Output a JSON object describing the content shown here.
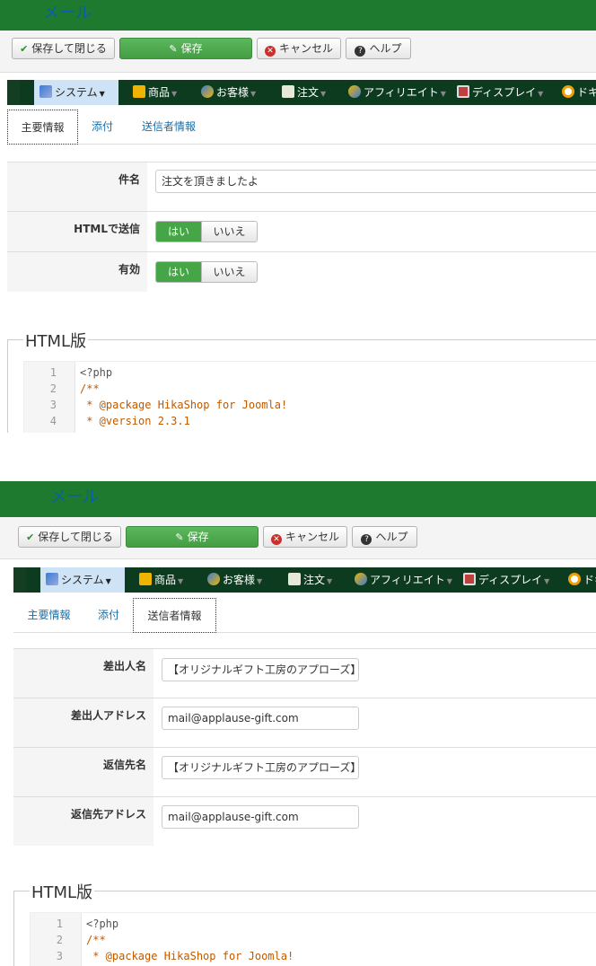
{
  "panel1": {
    "title": "メール",
    "toolbar": {
      "save_close": "保存して閉じる",
      "save": "保存",
      "cancel": "キャンセル",
      "help": "ヘルプ"
    },
    "menu": [
      "システム",
      "商品",
      "お客様",
      "注文",
      "アフィリエイト",
      "ディスプレイ",
      "ドキュ"
    ],
    "tabs": [
      "主要情報",
      "添付",
      "送信者情報"
    ],
    "active_tab": "主要情報",
    "fields": {
      "subject_label": "件名",
      "subject_value": "注文を頂きましたよ",
      "html_label": "HTMLで送信",
      "enabled_label": "有効",
      "yes": "はい",
      "no": "いいえ"
    },
    "html_version_legend": "HTML版",
    "code": [
      {
        "n": "1",
        "t": "<?php"
      },
      {
        "n": "2",
        "t": "/**"
      },
      {
        "n": "3",
        "t": " * @package HikaShop for Joomla!"
      },
      {
        "n": "4",
        "t": " * @version 2.3.1"
      }
    ]
  },
  "panel2": {
    "title": "メール",
    "toolbar": {
      "save_close": "保存して閉じる",
      "save": "保存",
      "cancel": "キャンセル",
      "help": "ヘルプ"
    },
    "menu": [
      "システム",
      "商品",
      "お客様",
      "注文",
      "アフィリエイト",
      "ディスプレイ",
      "ドキュ"
    ],
    "tabs": [
      "主要情報",
      "添付",
      "送信者情報"
    ],
    "active_tab": "送信者情報",
    "fields": {
      "from_name_label": "差出人名",
      "from_name_value": "【オリジナルギフト工房のアプローズ】",
      "from_email_label": "差出人アドレス",
      "from_email_value": "mail@applause-gift.com",
      "reply_name_label": "返信先名",
      "reply_name_value": "【オリジナルギフト工房のアプローズ】",
      "reply_email_label": "返信先アドレス",
      "reply_email_value": "mail@applause-gift.com"
    },
    "html_version_legend": "HTML版",
    "code": [
      {
        "n": "1",
        "t": "<?php"
      },
      {
        "n": "2",
        "t": "/**"
      },
      {
        "n": "3",
        "t": " * @package HikaShop for Joomla!"
      }
    ]
  },
  "colors": {
    "title_bar": "#1e7a2e",
    "menu_bar": "#0d3b1f",
    "save_green": "#5cb85c",
    "toggle_yes": "#46a546",
    "link_blue": "#1a6fa8"
  }
}
